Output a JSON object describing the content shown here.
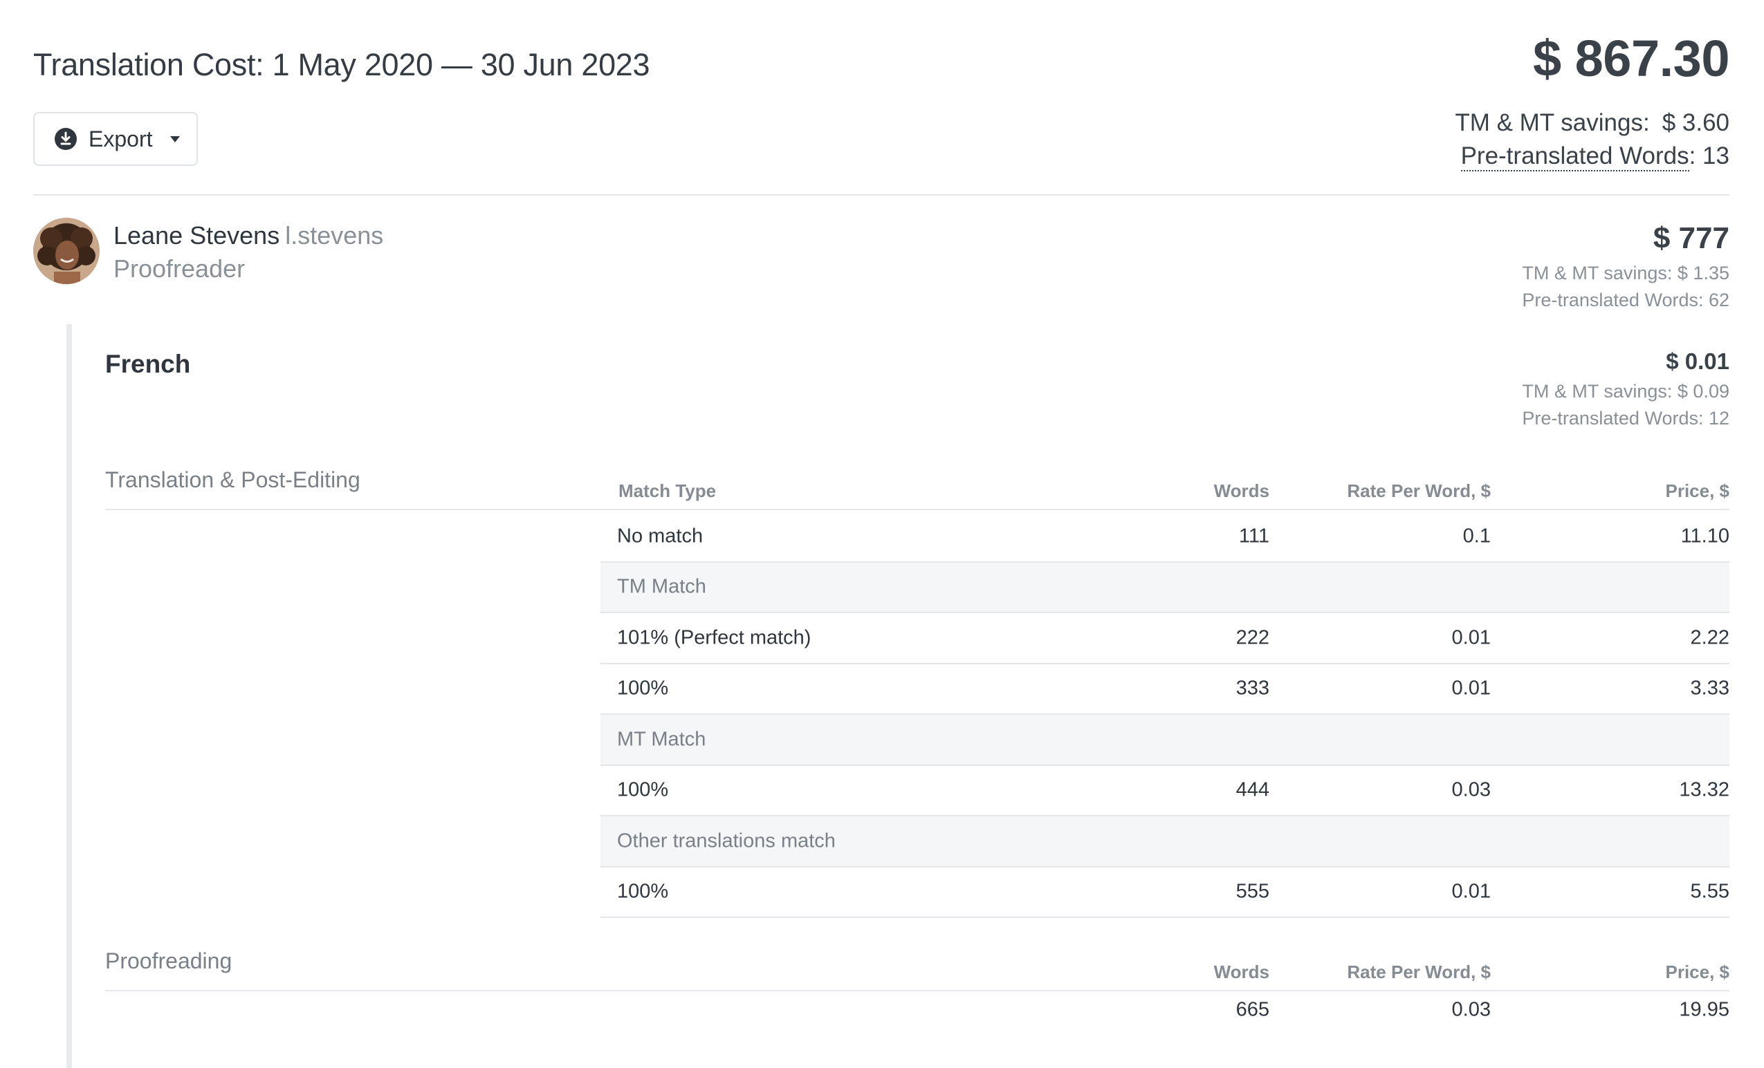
{
  "header": {
    "title": "Translation Cost: 1 May 2020 — 30 Jun 2023",
    "export_label": "Export",
    "total_amount": "$ 867.30",
    "savings_label": "TM & MT savings:",
    "savings_value": "$ 3.60",
    "pretranslated_label": "Pre-translated Words",
    "pretranslated_value": ": 13"
  },
  "user": {
    "name": "Leane Stevens",
    "login": "l.stevens",
    "role": "Proofreader",
    "total": "$ 777",
    "savings": "TM & MT savings: $ 1.35",
    "pretranslated": "Pre-translated Words: 62"
  },
  "language": {
    "name": "French",
    "total": "$ 0.01",
    "savings": "TM & MT savings: $ 0.09",
    "pretranslated": "Pre-translated Words: 12"
  },
  "translation_table": {
    "section_label": "Translation & Post-Editing",
    "headers": {
      "match_type": "Match Type",
      "words": "Words",
      "rate": "Rate Per Word, $",
      "price": "Price, $"
    },
    "rows": [
      {
        "type": "row",
        "match": "No match",
        "words": "111",
        "rate": "0.1",
        "price": "11.10"
      },
      {
        "type": "group",
        "match": "TM Match"
      },
      {
        "type": "row",
        "match": "101% (Perfect match)",
        "words": "222",
        "rate": "0.01",
        "price": "2.22"
      },
      {
        "type": "row",
        "match": "100%",
        "words": "333",
        "rate": "0.01",
        "price": "3.33"
      },
      {
        "type": "group",
        "match": "MT Match"
      },
      {
        "type": "row",
        "match": "100%",
        "words": "444",
        "rate": "0.03",
        "price": "13.32"
      },
      {
        "type": "group",
        "match": "Other translations match"
      },
      {
        "type": "row",
        "match": "100%",
        "words": "555",
        "rate": "0.01",
        "price": "5.55"
      }
    ]
  },
  "proofreading_table": {
    "section_label": "Proofreading",
    "headers": {
      "words": "Words",
      "rate": "Rate Per Word, $",
      "price": "Price, $"
    },
    "row": {
      "words": "665",
      "rate": "0.03",
      "price": "19.95"
    }
  },
  "icons": {
    "export": "download-circle-icon",
    "dropdown": "caret-down-icon",
    "avatar": "user-avatar"
  },
  "colors": {
    "text": "#2f363d",
    "muted": "#8a9097",
    "border": "#e3e5e8",
    "group_bg": "#f5f6f8"
  }
}
